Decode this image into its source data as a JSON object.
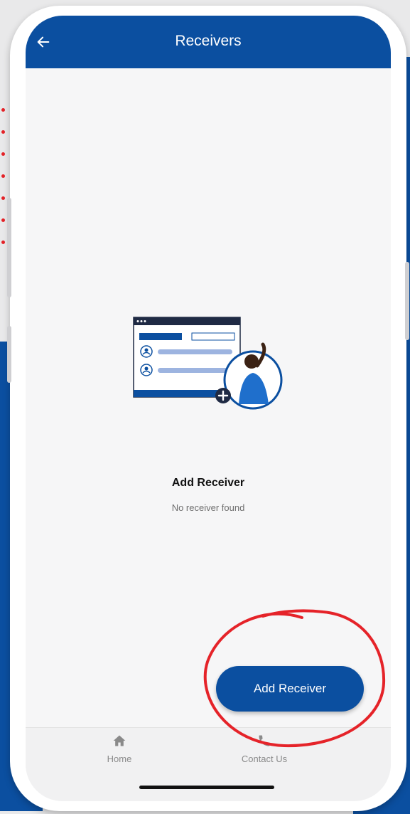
{
  "app_bar": {
    "title": "Receivers",
    "back_icon": "arrow-left-icon"
  },
  "empty_state": {
    "title": "Add Receiver",
    "subtitle": "No receiver found",
    "illustration": "add-receiver-illustration"
  },
  "fab": {
    "label": "Add Receiver"
  },
  "bottom_nav": {
    "items": [
      {
        "label": "Home",
        "icon": "home-icon"
      },
      {
        "label": "Contact Us",
        "icon": "phone-icon"
      }
    ]
  },
  "colors": {
    "primary": "#0b4fa0",
    "screen_bg": "#f6f6f7",
    "annotation": "#e52329",
    "nav_label": "#8a8a8a"
  }
}
